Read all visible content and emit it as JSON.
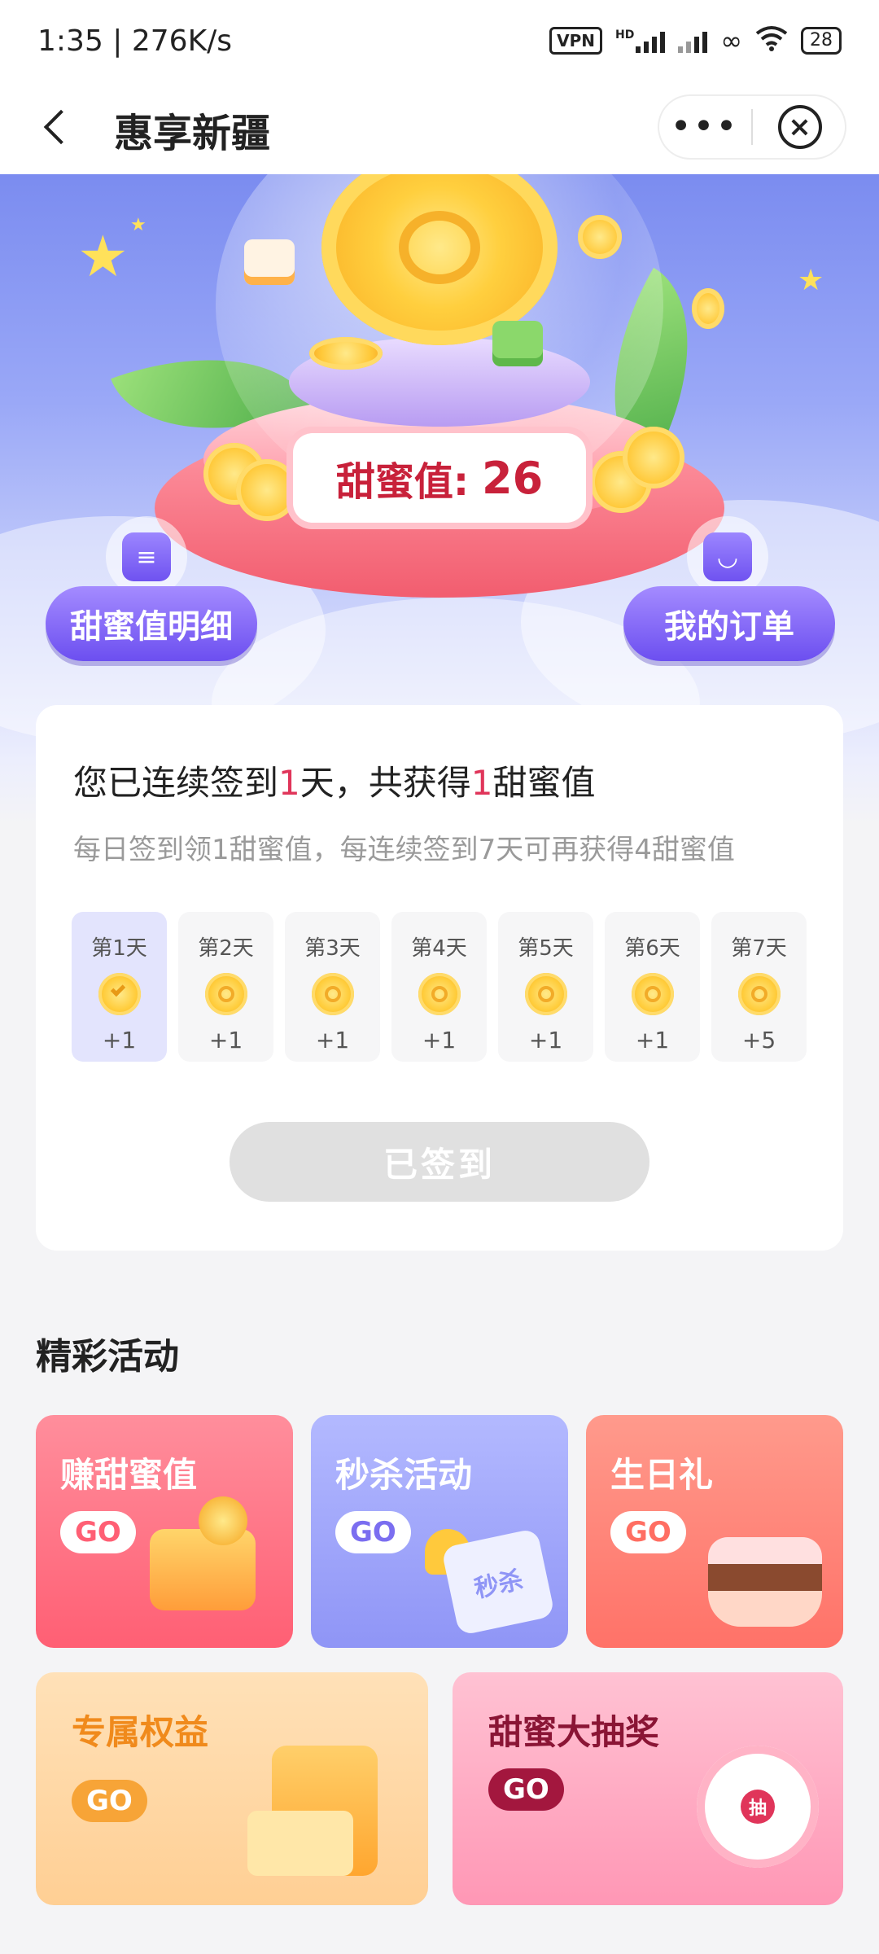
{
  "status_bar": {
    "time": "1:35 | 276K/s",
    "vpn": "VPN",
    "hd": "HD",
    "battery": "28"
  },
  "nav": {
    "title": "惠享新疆",
    "more_label": "•••",
    "close_label": "×"
  },
  "hero": {
    "sweet_label": "甜蜜值:",
    "sweet_value": "26",
    "left_button": "甜蜜值明细",
    "right_button": "我的订单"
  },
  "checkin": {
    "headline_prefix": "您已连续签到",
    "headline_days": "1",
    "headline_middle": "天，共获得",
    "headline_points": "1",
    "headline_suffix": "甜蜜值",
    "subtitle": "每日签到领1甜蜜值，每连续签到7天可再获得4甜蜜值",
    "days": [
      {
        "label": "第1天",
        "reward": "+1",
        "checked": true
      },
      {
        "label": "第2天",
        "reward": "+1",
        "checked": false
      },
      {
        "label": "第3天",
        "reward": "+1",
        "checked": false
      },
      {
        "label": "第4天",
        "reward": "+1",
        "checked": false
      },
      {
        "label": "第5天",
        "reward": "+1",
        "checked": false
      },
      {
        "label": "第6天",
        "reward": "+1",
        "checked": false
      },
      {
        "label": "第7天",
        "reward": "+5",
        "checked": false
      }
    ],
    "button_label": "已签到"
  },
  "activities": {
    "section_title": "精彩活动",
    "go_label": "GO",
    "tiles": [
      {
        "title": "赚甜蜜值"
      },
      {
        "title": "秒杀活动",
        "badge": "秒杀"
      },
      {
        "title": "生日礼"
      },
      {
        "title": "专属权益"
      },
      {
        "title": "甜蜜大抽奖",
        "badge": "抽"
      }
    ]
  }
}
